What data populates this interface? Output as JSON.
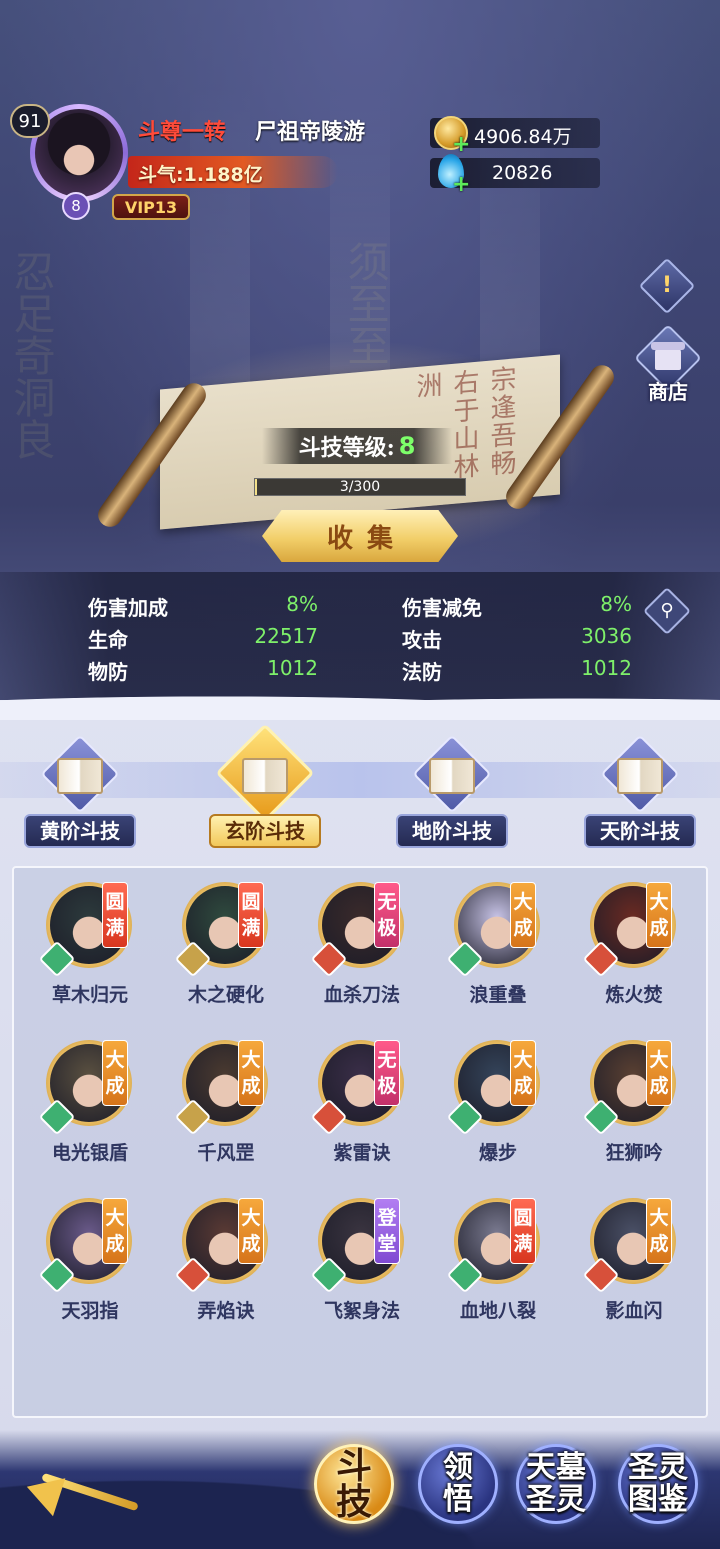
{
  "header": {
    "level": "91",
    "realm": "斗尊一转",
    "player_name": "尸祖帝陵游",
    "power_label": "斗气:1.188亿",
    "avatar_rank": "8",
    "vip": "VIP13"
  },
  "currencies": {
    "gold": "4906.84万",
    "diamond": "20826"
  },
  "side": {
    "info_symbol": "!",
    "shop_label": "商店"
  },
  "scroll": {
    "level_label": "斗技等级:",
    "level_value": "8",
    "progress_text": "3/300",
    "progress_fraction": 0.01,
    "collect_label": "收集"
  },
  "stats": {
    "rows": [
      {
        "left_label": "伤害加成",
        "left_value": "8%",
        "right_label": "伤害减免",
        "right_value": "8%"
      },
      {
        "left_label": "生命",
        "left_value": "22517",
        "right_label": "攻击",
        "right_value": "3036"
      },
      {
        "left_label": "物防",
        "left_value": "1012",
        "right_label": "法防",
        "right_value": "1012"
      }
    ]
  },
  "tabs": [
    {
      "label": "黄阶斗技",
      "active": false
    },
    {
      "label": "玄阶斗技",
      "active": true
    },
    {
      "label": "地阶斗技",
      "active": false
    },
    {
      "label": "天阶斗技",
      "active": false
    }
  ],
  "skills": [
    {
      "name": "草木归元",
      "grade": "圆满",
      "element": "wood",
      "portrait": "#2c3a3c"
    },
    {
      "name": "木之硬化",
      "grade": "圆满",
      "element": "metal",
      "portrait": "#2f4a3e"
    },
    {
      "name": "血杀刀法",
      "grade": "无极",
      "element": "fire",
      "portrait": "#3a2a2a"
    },
    {
      "name": "浪重叠",
      "grade": "大成",
      "element": "wood",
      "portrait": "#c7c3e6"
    },
    {
      "name": "炼火焚",
      "grade": "大成",
      "element": "fire",
      "portrait": "#6a2a22"
    },
    {
      "name": "电光银盾",
      "grade": "大成",
      "element": "wood",
      "portrait": "#5a5040"
    },
    {
      "name": "千风罡",
      "grade": "大成",
      "element": "metal",
      "portrait": "#4a3a30"
    },
    {
      "name": "紫雷诀",
      "grade": "无极",
      "element": "fire",
      "portrait": "#3a2e48"
    },
    {
      "name": "爆步",
      "grade": "大成",
      "element": "wood",
      "portrait": "#34445a"
    },
    {
      "name": "狂狮吟",
      "grade": "大成",
      "element": "wood",
      "portrait": "#5a4032"
    },
    {
      "name": "天羽指",
      "grade": "大成",
      "element": "wood",
      "portrait": "#6a5a8a"
    },
    {
      "name": "弄焰诀",
      "grade": "大成",
      "element": "fire",
      "portrait": "#5a3a34"
    },
    {
      "name": "飞絮身法",
      "grade": "登堂",
      "element": "wood",
      "portrait": "#3a3440"
    },
    {
      "name": "血地八裂",
      "grade": "圆满",
      "element": "wood",
      "portrait": "#7a7a90"
    },
    {
      "name": "影血闪",
      "grade": "大成",
      "element": "fire",
      "portrait": "#4a5066"
    }
  ],
  "bottom_nav": [
    {
      "label": "斗\n技",
      "active": true
    },
    {
      "label": "领\n悟",
      "active": false
    },
    {
      "label": "天墓\n圣灵",
      "active": false
    },
    {
      "label": "圣灵\n图鉴",
      "active": false
    }
  ],
  "icons": {
    "coin": "gold-coin-icon",
    "drop": "diamond-drop-icon",
    "search": "magnifier-icon",
    "back": "back-arrow-icon"
  },
  "colors": {
    "stat_value": "#7ef06a",
    "realm_text": "#ff4b3a",
    "active_tab": "#f2c85a"
  }
}
